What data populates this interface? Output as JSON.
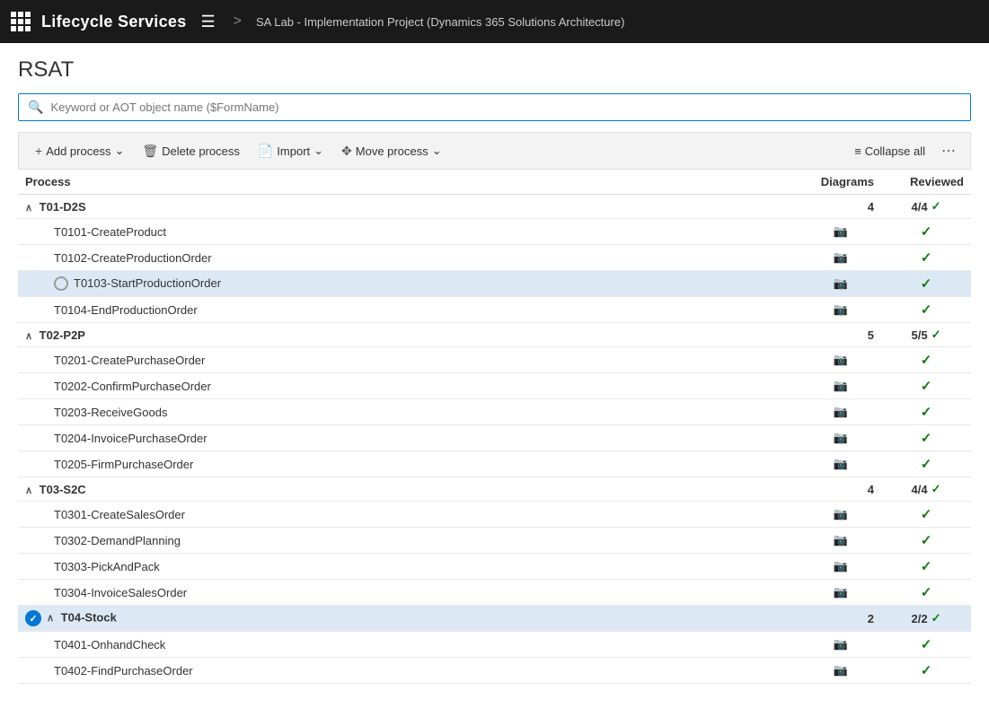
{
  "topbar": {
    "title": "Lifecycle Services",
    "breadcrumb": "SA Lab - Implementation Project (Dynamics 365 Solutions Architecture)"
  },
  "page": {
    "title": "RSAT",
    "search_placeholder": "Keyword or AOT object name ($FormName)"
  },
  "toolbar": {
    "add_process": "Add process",
    "delete_process": "Delete process",
    "import": "Import",
    "move_process": "Move process",
    "collapse_all": "Collapse all"
  },
  "table": {
    "col_process": "Process",
    "col_diagrams": "Diagrams",
    "col_reviewed": "Reviewed",
    "groups": [
      {
        "id": "T01-D2S",
        "label": "T01-D2S",
        "diagrams": "4",
        "reviewed": "4/4",
        "expanded": true,
        "selected": false,
        "children": [
          {
            "id": "T0101",
            "label": "T0101-CreateProduct",
            "selected": false,
            "hasRadio": false,
            "hasCheck": false
          },
          {
            "id": "T0102",
            "label": "T0102-CreateProductionOrder",
            "selected": false,
            "hasRadio": false,
            "hasCheck": false
          },
          {
            "id": "T0103",
            "label": "T0103-StartProductionOrder",
            "selected": true,
            "hasRadio": true,
            "hasCheck": false
          },
          {
            "id": "T0104",
            "label": "T0104-EndProductionOrder",
            "selected": false,
            "hasRadio": false,
            "hasCheck": false
          }
        ]
      },
      {
        "id": "T02-P2P",
        "label": "T02-P2P",
        "diagrams": "5",
        "reviewed": "5/5",
        "expanded": true,
        "selected": false,
        "children": [
          {
            "id": "T0201",
            "label": "T0201-CreatePurchaseOrder",
            "selected": false,
            "hasRadio": false,
            "hasCheck": false
          },
          {
            "id": "T0202",
            "label": "T0202-ConfirmPurchaseOrder",
            "selected": false,
            "hasRadio": false,
            "hasCheck": false
          },
          {
            "id": "T0203",
            "label": "T0203-ReceiveGoods",
            "selected": false,
            "hasRadio": false,
            "hasCheck": false
          },
          {
            "id": "T0204",
            "label": "T0204-InvoicePurchaseOrder",
            "selected": false,
            "hasRadio": false,
            "hasCheck": false
          },
          {
            "id": "T0205",
            "label": "T0205-FirmPurchaseOrder",
            "selected": false,
            "hasRadio": false,
            "hasCheck": false
          }
        ]
      },
      {
        "id": "T03-S2C",
        "label": "T03-S2C",
        "diagrams": "4",
        "reviewed": "4/4",
        "expanded": true,
        "selected": false,
        "children": [
          {
            "id": "T0301",
            "label": "T0301-CreateSalesOrder",
            "selected": false,
            "hasRadio": false,
            "hasCheck": false
          },
          {
            "id": "T0302",
            "label": "T0302-DemandPlanning",
            "selected": false,
            "hasRadio": false,
            "hasCheck": false
          },
          {
            "id": "T0303",
            "label": "T0303-PickAndPack",
            "selected": false,
            "hasRadio": false,
            "hasCheck": false
          },
          {
            "id": "T0304",
            "label": "T0304-InvoiceSalesOrder",
            "selected": false,
            "hasRadio": false,
            "hasCheck": false
          }
        ]
      },
      {
        "id": "T04-Stock",
        "label": "T04-Stock",
        "diagrams": "2",
        "reviewed": "2/2",
        "expanded": true,
        "selected": true,
        "children": [
          {
            "id": "T0401",
            "label": "T0401-OnhandCheck",
            "selected": false,
            "hasRadio": false,
            "hasCheck": false
          },
          {
            "id": "T0402",
            "label": "T0402-FindPurchaseOrder",
            "selected": false,
            "hasRadio": false,
            "hasCheck": false
          }
        ]
      }
    ]
  }
}
